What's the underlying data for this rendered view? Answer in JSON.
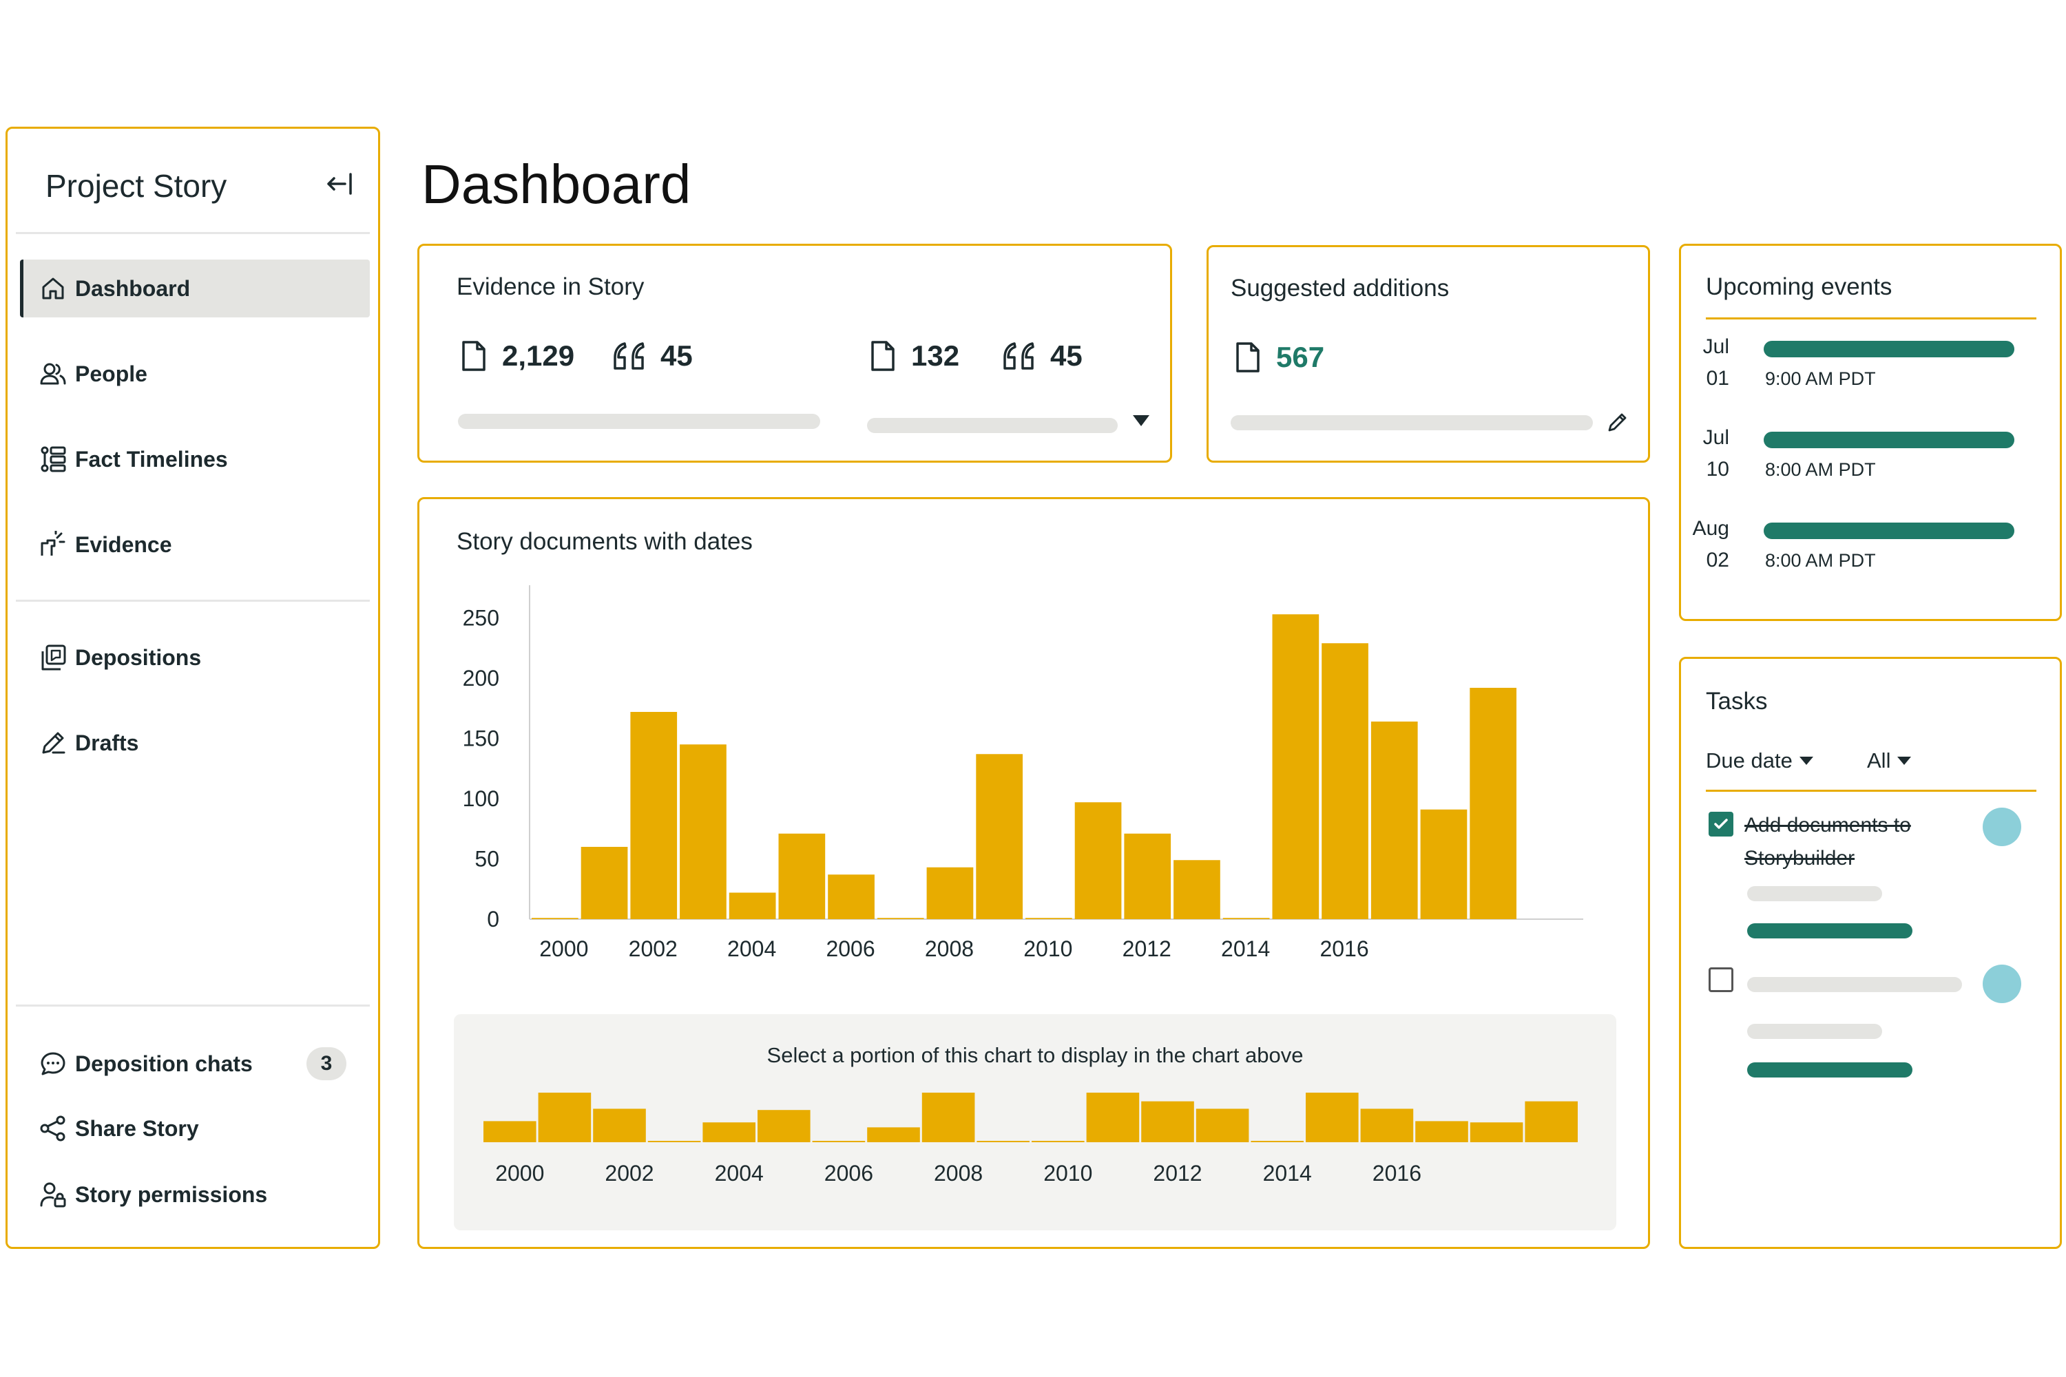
{
  "sidebar": {
    "title": "Project Story",
    "collapse_icon": "collapse-left-icon",
    "items": [
      {
        "label": "Dashboard",
        "icon": "home-icon"
      },
      {
        "label": "People",
        "icon": "people-icon"
      },
      {
        "label": "Fact Timelines",
        "icon": "timeline-icon"
      },
      {
        "label": "Evidence",
        "icon": "evidence-icon"
      },
      {
        "label": "Depositions",
        "icon": "depositions-icon"
      },
      {
        "label": "Drafts",
        "icon": "pen-icon"
      }
    ],
    "bottom_items": [
      {
        "label": "Deposition chats",
        "icon": "chat-icon",
        "badge": "3"
      },
      {
        "label": "Share Story",
        "icon": "share-icon"
      },
      {
        "label": "Story permissions",
        "icon": "permissions-icon"
      }
    ]
  },
  "page_title": "Dashboard",
  "evidence_card": {
    "title": "Evidence in Story",
    "docs_1": "2,129",
    "quotes_1": "45",
    "docs_2": "132",
    "quotes_2": "45"
  },
  "suggested_card": {
    "title": "Suggested additions",
    "count": "567"
  },
  "events_card": {
    "title": "Upcoming events",
    "events": [
      {
        "month": "Jul",
        "day": "01",
        "time": "9:00 AM PDT"
      },
      {
        "month": "Jul",
        "day": "10",
        "time": "8:00 AM PDT"
      },
      {
        "month": "Aug",
        "day": "02",
        "time": "8:00 AM PDT"
      }
    ]
  },
  "tasks_card": {
    "title": "Tasks",
    "filter_due": "Due date",
    "filter_all": "All",
    "task_1": "Add documents to Storybuilder"
  },
  "chart_card": {
    "title": "Story documents with dates",
    "selector_caption": "Select a portion of this chart to display in the chart above"
  },
  "colors": {
    "accent": "#e8ac00",
    "teal": "#1f7a68",
    "avatar": "#8ccfd9"
  },
  "chart_data": [
    {
      "type": "bar",
      "title": "Story documents with dates",
      "x": [
        2000,
        2001,
        2002,
        2003,
        2004,
        2005,
        2006,
        2007,
        2008,
        2009,
        2010,
        2011,
        2012,
        2013,
        2014,
        2015,
        2016,
        2017,
        2018,
        2019
      ],
      "values": [
        1,
        60,
        172,
        145,
        22,
        71,
        37,
        1,
        43,
        137,
        1,
        97,
        71,
        49,
        1,
        253,
        229,
        164,
        91,
        192
      ],
      "tick_labels": [
        "2000",
        "2002",
        "2004",
        "2006",
        "2008",
        "2010",
        "2012",
        "2014",
        "2016"
      ],
      "ylim": [
        0,
        280
      ],
      "yticks": [
        0,
        50,
        100,
        150,
        200,
        250
      ],
      "grid": false
    },
    {
      "type": "bar",
      "title": "",
      "x": [
        2000,
        2001,
        2002,
        2003,
        2004,
        2005,
        2006,
        2007,
        2008,
        2009,
        2010,
        2011,
        2012,
        2013,
        2014,
        2015,
        2016,
        2017,
        2018,
        2019
      ],
      "values": [
        17,
        40,
        27,
        1,
        16,
        26,
        1,
        12,
        40,
        1,
        1,
        40,
        33,
        27,
        1,
        40,
        27,
        17,
        16,
        33
      ],
      "tick_labels": [
        "2000",
        "2002",
        "2004",
        "2006",
        "2008",
        "2010",
        "2012",
        "2014",
        "2016"
      ],
      "ylim": [
        0,
        40
      ]
    }
  ]
}
